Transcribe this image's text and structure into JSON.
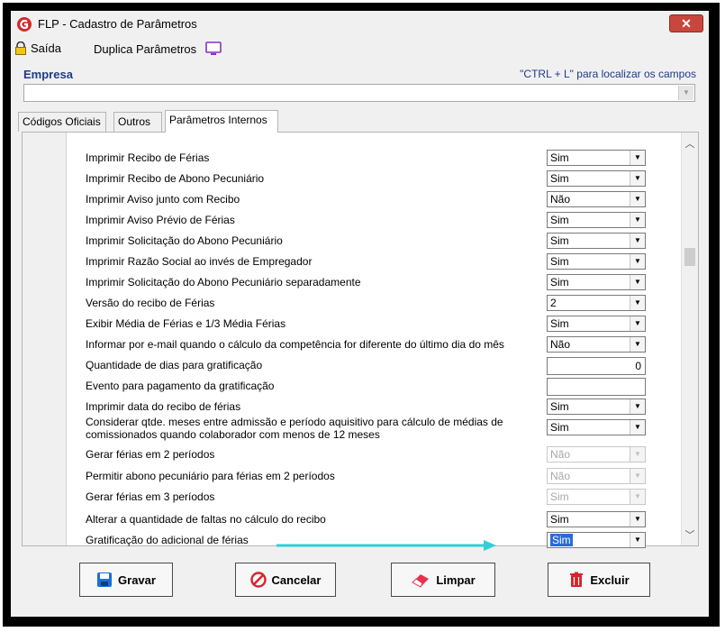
{
  "window": {
    "title": "FLP - Cadastro de Parâmetros",
    "close_label": "✕"
  },
  "toolbar": {
    "saida_label": "Saída",
    "duplica_label": "Duplica Parâmetros"
  },
  "empresa": {
    "label": "Empresa",
    "hint": "\"CTRL + L\" para localizar os campos",
    "value": ""
  },
  "tabs": [
    {
      "label": "Códigos Oficiais",
      "active": false
    },
    {
      "label": "Outros",
      "active": false
    },
    {
      "label": "Parâmetros Internos",
      "active": true
    }
  ],
  "rows": [
    {
      "label": "Imprimir Recibo de Férias",
      "type": "select",
      "value": "Sim"
    },
    {
      "label": "Imprimir Recibo de Abono Pecuniário",
      "type": "select",
      "value": "Sim"
    },
    {
      "label": "Imprimir Aviso junto com Recibo",
      "type": "select",
      "value": "Não"
    },
    {
      "label": "Imprimir Aviso Prévio de Férias",
      "type": "select",
      "value": "Sim"
    },
    {
      "label": "Imprimir Solicitação do Abono Pecuniário",
      "type": "select",
      "value": "Sim"
    },
    {
      "label": "Imprimir Razão Social ao invés de Empregador",
      "type": "select",
      "value": "Sim"
    },
    {
      "label": "Imprimir Solicitação do Abono Pecuniário separadamente",
      "type": "select",
      "value": "Sim"
    },
    {
      "label": "Versão do recibo de Férias",
      "type": "select",
      "value": "2"
    },
    {
      "label": "Exibir Média de Férias e 1/3  Média Férias",
      "type": "select",
      "value": "Sim"
    },
    {
      "label": "Informar por e-mail quando o cálculo da competência for diferente do último dia do mês",
      "type": "select",
      "value": "Não"
    },
    {
      "label": "Quantidade de dias para gratificação",
      "type": "number",
      "value": "0"
    },
    {
      "label": "Evento para pagamento da gratificação",
      "type": "number",
      "value": ""
    },
    {
      "label": "Imprimir data do recibo de férias",
      "type": "select",
      "value": "Sim"
    },
    {
      "label": "Considerar qtde. meses entre admissão e período aquisitivo para cálculo de médias de",
      "label2": "comissionados quando colaborador com menos de 12 meses",
      "type": "select",
      "value": "Sim"
    },
    {
      "label": "Gerar férias em 2 períodos",
      "type": "select",
      "value": "Não",
      "disabled": true
    },
    {
      "label": "Permitir abono pecuniário para férias em 2 períodos",
      "type": "select",
      "value": "Não",
      "disabled": true
    },
    {
      "label": "Gerar férias em 3 períodos",
      "type": "select",
      "value": "Sim",
      "disabled": true
    },
    {
      "label": "Alterar a quantidade de faltas no cálculo do recibo",
      "type": "select",
      "value": "Sim"
    },
    {
      "label": "Gratificação do adicional de férias",
      "type": "select",
      "value": "Sim",
      "selected": true
    }
  ],
  "buttons": {
    "gravar": "Gravar",
    "cancelar": "Cancelar",
    "limpar": "Limpar",
    "excluir": "Excluir"
  },
  "colors": {
    "accent_blue": "#1f3a8a",
    "annotation_arrow": "#2fd0d8",
    "selection": "#2a6bd8"
  }
}
